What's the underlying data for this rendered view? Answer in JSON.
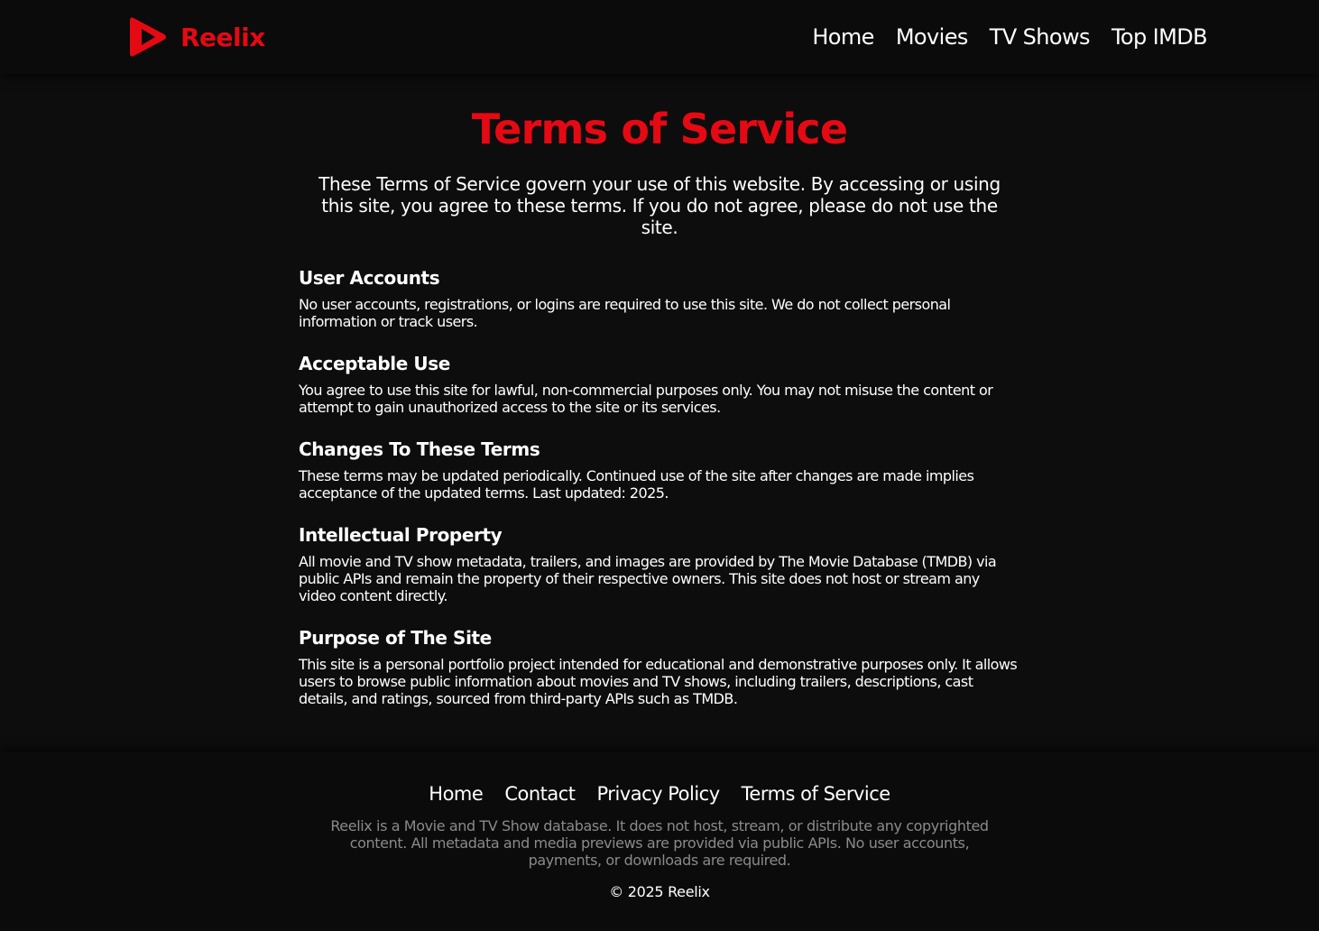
{
  "brand": {
    "name": "Reelix",
    "logo_icon": "play-triangle-icon",
    "accent_color": "#e50914"
  },
  "nav": {
    "items": [
      "Home",
      "Movies",
      "TV Shows",
      "Top IMDB"
    ]
  },
  "page": {
    "title": "Terms of Service",
    "intro": "These Terms of Service govern your use of this website. By accessing or using this site, you agree to these terms. If you do not agree, please do not use the site."
  },
  "sections": [
    {
      "heading": "User Accounts",
      "body": "No user accounts, registrations, or logins are required to use this site. We do not collect personal information or track users."
    },
    {
      "heading": "Acceptable Use",
      "body": "You agree to use this site for lawful, non-commercial purposes only. You may not misuse the content or attempt to gain unauthorized access to the site or its services."
    },
    {
      "heading": "Changes To These Terms",
      "body": "These terms may be updated periodically. Continued use of the site after changes are made implies acceptance of the updated terms. Last updated: 2025."
    },
    {
      "heading": "Intellectual Property",
      "body": "All movie and TV show metadata, trailers, and images are provided by The Movie Database (TMDB) via public APIs and remain the property of their respective owners. This site does not host or stream any video content directly."
    },
    {
      "heading": "Purpose of The Site",
      "body": "This site is a personal portfolio project intended for educational and demonstrative purposes only. It allows users to browse public information about movies and TV shows, including trailers, descriptions, cast details, and ratings, sourced from third-party APIs such as TMDB."
    }
  ],
  "footer": {
    "links": [
      "Home",
      "Contact",
      "Privacy Policy",
      "Terms of Service"
    ],
    "disclaimer": "Reelix is a Movie and TV Show database. It does not host, stream, or distribute any copyrighted content. All metadata and media previews are provided via public APIs. No user accounts, payments, or downloads are required.",
    "copyright": "© 2025 Reelix"
  }
}
